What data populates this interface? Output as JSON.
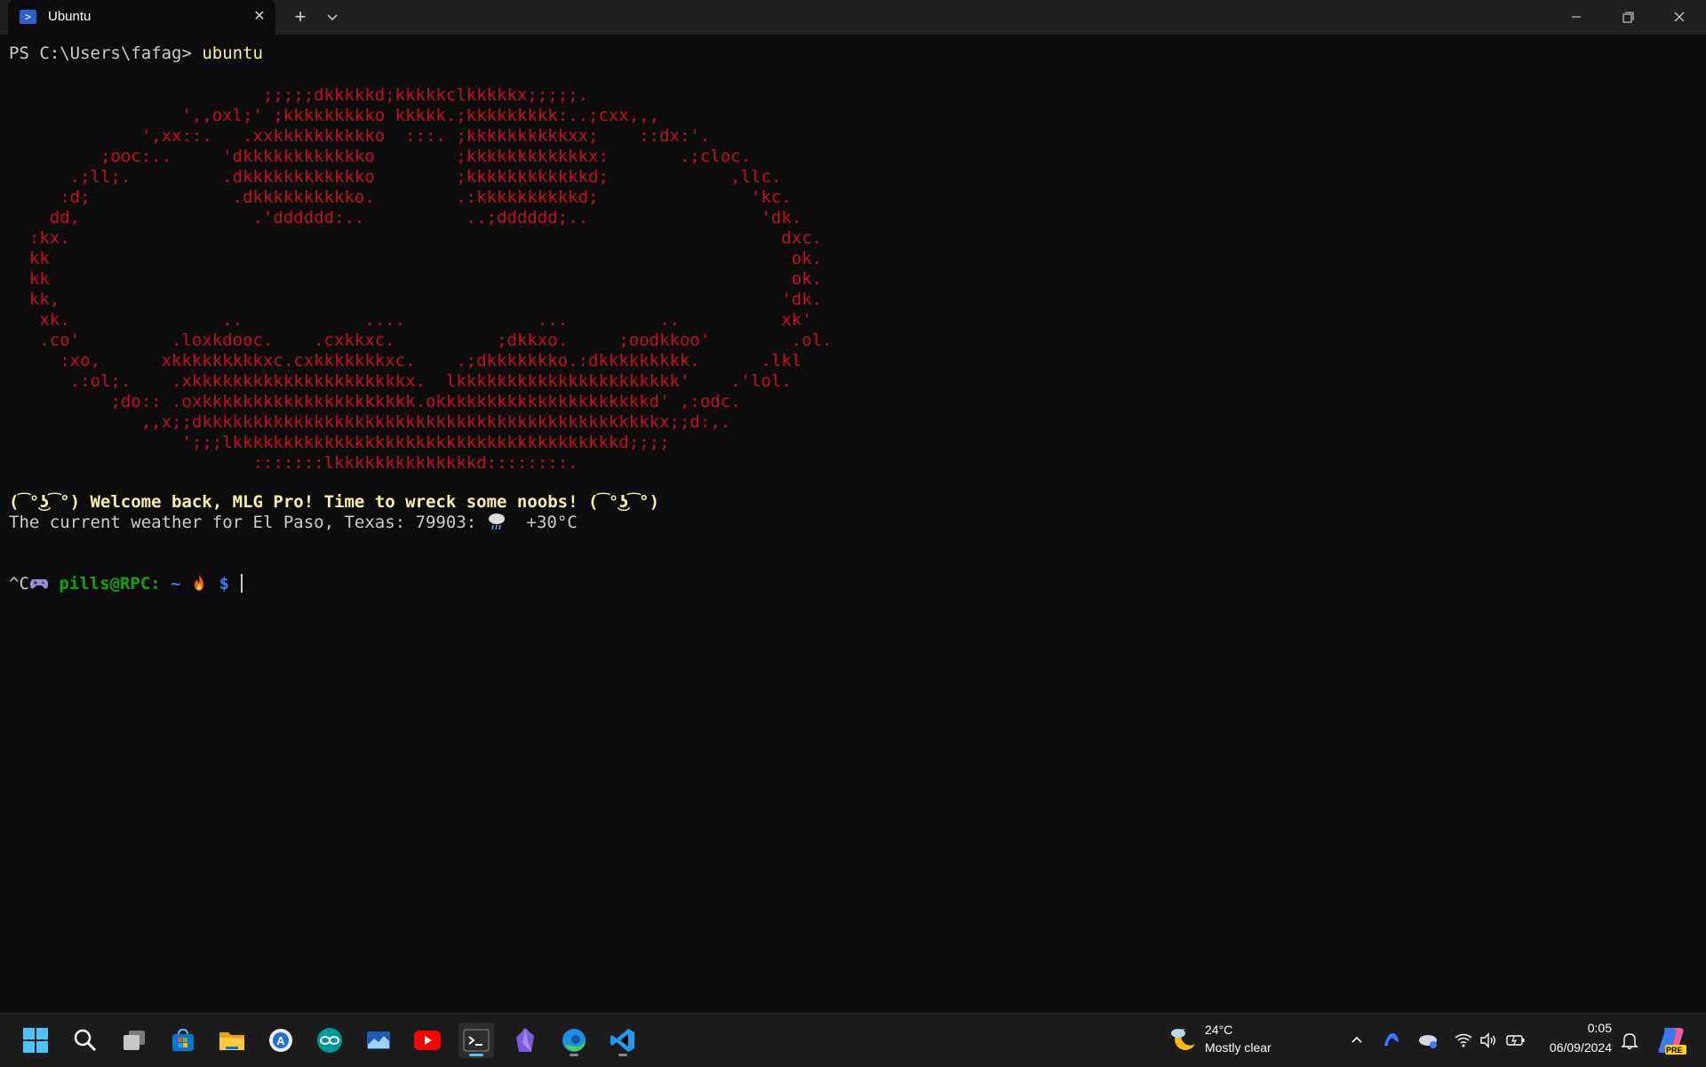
{
  "window": {
    "tab_title": "Ubuntu",
    "tab_icon": "terminal-powershell-icon",
    "new_tab_symbol": "+",
    "close_symbol": "✕"
  },
  "terminal": {
    "ps_prompt": "PS C:\\Users\\fafag> ",
    "ps_command": "ubuntu",
    "ascii_art": "                         ;;;;;dkkkkkd;kkkkkclkkkkkx;;;;;.\n                 ',,oxl;' ;kkkkkkkkko kkkkk.;kkkkkkkkk:..;cxx,,,\n             ',xx::.   .xxkkkkkkkkkko  :::. ;kkkkkkkkkkxx;    ::dx:'.\n         ;ooc:..     'dkkkkkkkkkkkko        ;kkkkkkkkkkkkx:       .;cloc.\n      .;ll;.         .dkkkkkkkkkkkko        ;kkkkkkkkkkkkd;            ,llc.\n     :d;              .dkkkkkkkkkko.        .:kkkkkkkkkkd;               'kc.\n    dd,                 .'dddddd:..          ..;dddddd;..                 'dk.\n  :kx.                                                                      dxc.\n  kk                                                                         ok.\n  kk                                                                         ok.\n  kk,                                                                       'dk.\n   xk.               ..            ....             ...         ..          xk'\n   .co'         .loxkdooc.    .cxkkxc.          ;dkkxo.     ;oodkkoo'        .ol.\n     :xo,      xkkkkkkkkkxc.cxkkkkkkkxc.    .;dkkkkkkko.:dkkkkkkkkk.      .lkl\n      .:ol;.    .xkkkkkkkkkkkkkkkkkkkkkx.  lkkkkkkkkkkkkkkkkkkkkkk'    .'lol.\n          ;do:: .oxkkkkkkkkkkkkkkkkkkkkk.okkkkkkkkkkkkkkkkkkkkkd' ,:odc.\n             ,,x;;dkkkkkkkkkkkkkkkkkkkkkkkkkkkkkkkkkkkkkkkkkkkkkx;;d:,.\n                 ';;;lkkkkkkkkkkkkkkkkkkkkkkkkkkkkkkkkkkkkkkd;;;;\n                        :::::::lkkkkkkkkkkkkkkd::::::::.",
    "welcome_message": "(͡°͜ʖ͡°) Welcome back, MLG Pro! Time to wreck some noobs! (͡°͜ʖ͡°)",
    "weather_prefix": "The current weather for El Paso, Texas: 79903: ",
    "weather_icon": "cloud-rain-icon",
    "weather_suffix": "  +30°C",
    "interrupt": "^C",
    "gamepad_icon": "gamepad-icon",
    "user_host": " pills@RPC:",
    "tilde": " ~ ",
    "fire_icon": "fire-icon",
    "dollar": " $ "
  },
  "taskbar": {
    "apps": [
      {
        "name": "start-button",
        "icon": "windows-logo-icon"
      },
      {
        "name": "search-button",
        "icon": "search-icon"
      },
      {
        "name": "task-view-button",
        "icon": "task-view-icon"
      },
      {
        "name": "microsoft-store",
        "icon": "store-icon"
      },
      {
        "name": "file-explorer",
        "icon": "folder-icon"
      },
      {
        "name": "app-a",
        "icon": "a-logo-icon"
      },
      {
        "name": "arduino-ide",
        "icon": "arduino-icon"
      },
      {
        "name": "mail-app",
        "icon": "mail-icon"
      },
      {
        "name": "youtube",
        "icon": "youtube-icon"
      },
      {
        "name": "windows-terminal",
        "icon": "terminal-icon"
      },
      {
        "name": "obsidian",
        "icon": "obsidian-icon"
      },
      {
        "name": "microsoft-edge",
        "icon": "edge-icon"
      },
      {
        "name": "vs-code",
        "icon": "vscode-icon"
      }
    ],
    "weather": {
      "icon": "moon-cloud-icon",
      "temp": "24°C",
      "condition": "Mostly clear"
    },
    "tray_icons": [
      "chevron-up-icon",
      "app-tray-icon",
      "onedrive-icon",
      "wifi-icon",
      "volume-icon",
      "battery-icon"
    ],
    "clock": {
      "time": "0:05",
      "date": "06/09/2024"
    },
    "notification_icon": "bell-icon",
    "copilot_icon": "copilot-icon",
    "copilot_badge": "PRE"
  }
}
